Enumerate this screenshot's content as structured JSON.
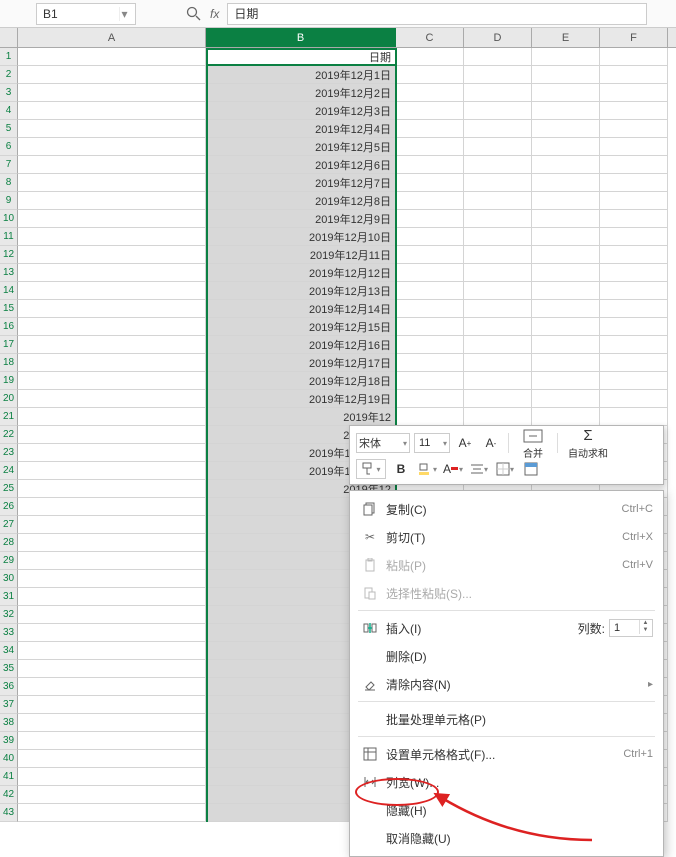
{
  "formulaBar": {
    "nameBox": "B1",
    "formulaValue": "日期"
  },
  "columns": [
    "A",
    "B",
    "C",
    "D",
    "E",
    "F"
  ],
  "selectedColumn": "B",
  "rows": [
    {
      "num": 1,
      "b": "日期"
    },
    {
      "num": 2,
      "b": "2019年12月1日"
    },
    {
      "num": 3,
      "b": "2019年12月2日"
    },
    {
      "num": 4,
      "b": "2019年12月3日"
    },
    {
      "num": 5,
      "b": "2019年12月4日"
    },
    {
      "num": 6,
      "b": "2019年12月5日"
    },
    {
      "num": 7,
      "b": "2019年12月6日"
    },
    {
      "num": 8,
      "b": "2019年12月7日"
    },
    {
      "num": 9,
      "b": "2019年12月8日"
    },
    {
      "num": 10,
      "b": "2019年12月9日"
    },
    {
      "num": 11,
      "b": "2019年12月10日"
    },
    {
      "num": 12,
      "b": "2019年12月11日"
    },
    {
      "num": 13,
      "b": "2019年12月12日"
    },
    {
      "num": 14,
      "b": "2019年12月13日"
    },
    {
      "num": 15,
      "b": "2019年12月14日"
    },
    {
      "num": 16,
      "b": "2019年12月15日"
    },
    {
      "num": 17,
      "b": "2019年12月16日"
    },
    {
      "num": 18,
      "b": "2019年12月17日"
    },
    {
      "num": 19,
      "b": "2019年12月18日"
    },
    {
      "num": 20,
      "b": "2019年12月19日"
    },
    {
      "num": 21,
      "b": "2019年12"
    },
    {
      "num": 22,
      "b": "2019年12"
    },
    {
      "num": 23,
      "b": "2019年12月22日"
    },
    {
      "num": 24,
      "b": "2019年12月23日"
    },
    {
      "num": 25,
      "b": "2019年12"
    },
    {
      "num": 26,
      "b": ""
    },
    {
      "num": 27,
      "b": ""
    },
    {
      "num": 28,
      "b": ""
    },
    {
      "num": 29,
      "b": ""
    },
    {
      "num": 30,
      "b": ""
    },
    {
      "num": 31,
      "b": ""
    },
    {
      "num": 32,
      "b": ""
    },
    {
      "num": 33,
      "b": ""
    },
    {
      "num": 34,
      "b": ""
    },
    {
      "num": 35,
      "b": ""
    },
    {
      "num": 36,
      "b": ""
    },
    {
      "num": 37,
      "b": ""
    },
    {
      "num": 38,
      "b": ""
    },
    {
      "num": 39,
      "b": ""
    },
    {
      "num": 40,
      "b": ""
    },
    {
      "num": 41,
      "b": ""
    },
    {
      "num": 42,
      "b": ""
    },
    {
      "num": 43,
      "b": ""
    }
  ],
  "miniToolbar": {
    "font": "宋体",
    "size": "11",
    "mergeLabel": "合并",
    "sumLabel": "自动求和"
  },
  "contextMenu": {
    "copy": {
      "label": "复制(C)",
      "shortcut": "Ctrl+C"
    },
    "cut": {
      "label": "剪切(T)",
      "shortcut": "Ctrl+X"
    },
    "paste": {
      "label": "粘贴(P)",
      "shortcut": "Ctrl+V"
    },
    "pasteSpecial": {
      "label": "选择性粘贴(S)..."
    },
    "insert": {
      "label": "插入(I)",
      "countLabel": "列数:",
      "countValue": "1"
    },
    "delete": {
      "label": "删除(D)"
    },
    "clear": {
      "label": "清除内容(N)"
    },
    "batch": {
      "label": "批量处理单元格(P)"
    },
    "format": {
      "label": "设置单元格格式(F)...",
      "shortcut": "Ctrl+1"
    },
    "colWidth": {
      "label": "列宽(W)..."
    },
    "hide": {
      "label": "隐藏(H)"
    },
    "unhide": {
      "label": "取消隐藏(U)"
    }
  }
}
